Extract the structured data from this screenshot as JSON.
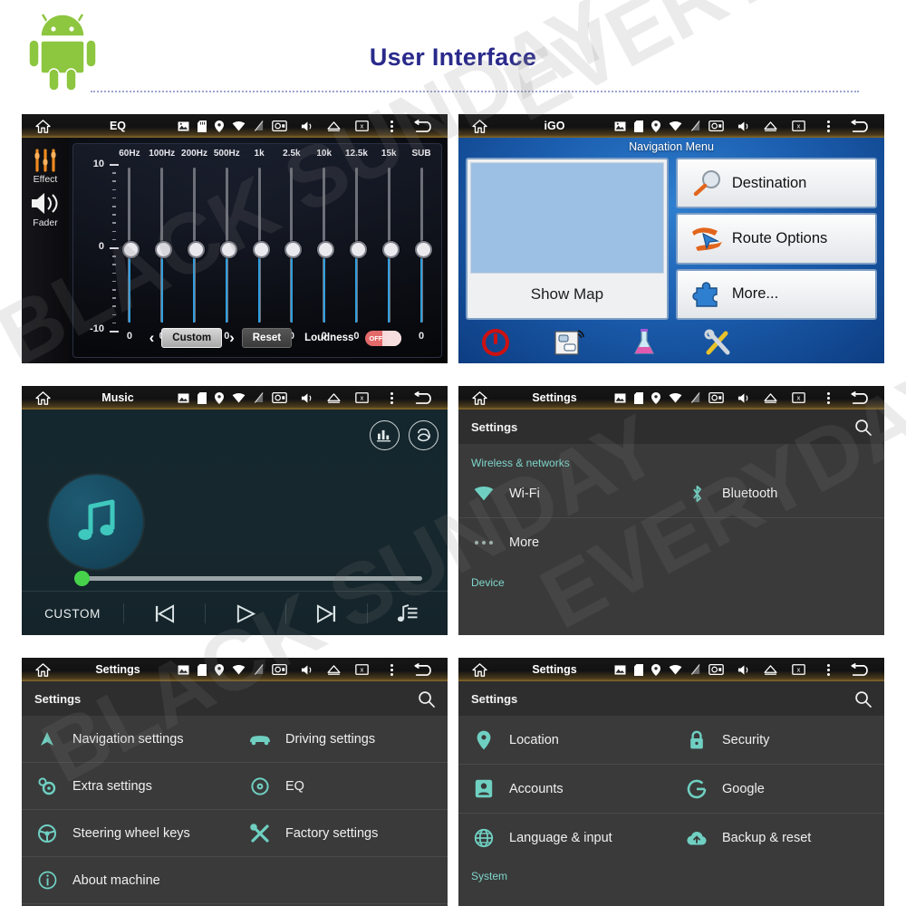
{
  "header": {
    "title": "User Interface",
    "logo_icon": "android-robot-logo",
    "title_color": "#2a2a8c"
  },
  "watermark": {
    "line1": "BLACK SUNDAY",
    "line2": "EVERYDAY"
  },
  "statusbar_icons": [
    "image-icon",
    "sd-card-icon",
    "location-pin-icon",
    "wifi-icon",
    "signal-off-icon",
    "camera-icon",
    "mute-volume-icon",
    "eject-icon",
    "screen-off-icon",
    "overflow-menu-icon"
  ],
  "screens": {
    "eq": {
      "statusbar_title": "EQ",
      "side": {
        "effect_label": "Effect",
        "fader_label": "Fader",
        "effect_icon": "sliders-icon",
        "fader_icon": "speaker-waves-icon",
        "effect_color": "#f08a1e"
      },
      "bands": [
        "60Hz",
        "100Hz",
        "200Hz",
        "500Hz",
        "1k",
        "2.5k",
        "10k",
        "12.5k",
        "15k",
        "SUB"
      ],
      "values": [
        0,
        0,
        0,
        0,
        0,
        0,
        0,
        0,
        0,
        0
      ],
      "axis": {
        "max": "10",
        "mid": "0",
        "min": "-10"
      },
      "controls": {
        "prev_arrow": "‹",
        "next_arrow": "›",
        "preset_label": "Custom",
        "reset_label": "Reset",
        "loudness_label": "Loudness",
        "loudness_state": "OFF"
      }
    },
    "igo": {
      "statusbar_title": "iGO",
      "menu_title": "Navigation Menu",
      "show_map_label": "Show Map",
      "buttons": [
        {
          "label": "Destination",
          "icon": "magnifier-icon"
        },
        {
          "label": "Route Options",
          "icon": "route-arrow-icon"
        },
        {
          "label": "More...",
          "icon": "puzzle-piece-icon"
        }
      ],
      "toolbar_icons": [
        "power-icon",
        "traffic-tmc-icon",
        "beaker-icon",
        "tools-icon"
      ]
    },
    "music": {
      "statusbar_title": "Music",
      "equalizer_icon": "equalizer-icon",
      "repeat_icon": "repeat-icon",
      "album_art_icon": "music-note-icon",
      "progress_percent": 2,
      "mode_label": "CUSTOM",
      "transport": [
        {
          "name": "previous",
          "icon": "skip-previous-icon"
        },
        {
          "name": "play",
          "icon": "play-icon"
        },
        {
          "name": "next",
          "icon": "skip-next-icon"
        }
      ],
      "playlist_icon": "playlist-icon"
    },
    "settings_wireless": {
      "statusbar_title": "Settings",
      "head_title": "Settings",
      "search_icon": "search-icon",
      "groups": [
        {
          "title": "Wireless & networks",
          "rows": [
            {
              "label": "Wi-Fi",
              "icon": "wifi-icon"
            },
            {
              "label": "Bluetooth",
              "icon": "bluetooth-icon"
            },
            {
              "label": "More",
              "icon": "more-dots-icon"
            }
          ]
        },
        {
          "title": "Device",
          "rows": []
        }
      ]
    },
    "settings_device": {
      "statusbar_title": "Settings",
      "head_title": "Settings",
      "search_icon": "search-icon",
      "rows": [
        {
          "label": "Navigation settings",
          "icon": "navigation-arrow-icon"
        },
        {
          "label": "Driving settings",
          "icon": "car-icon"
        },
        {
          "label": "Extra settings",
          "icon": "gears-icon"
        },
        {
          "label": "EQ",
          "icon": "speaker-icon"
        },
        {
          "label": "Steering wheel keys",
          "icon": "steering-wheel-icon"
        },
        {
          "label": "Factory settings",
          "icon": "tools-icon"
        },
        {
          "label": "About machine",
          "icon": "info-icon"
        }
      ]
    },
    "settings_personal": {
      "statusbar_title": "Settings",
      "head_title": "Settings",
      "search_icon": "search-icon",
      "rows": [
        {
          "label": "Location",
          "icon": "location-pin-icon"
        },
        {
          "label": "Security",
          "icon": "lock-icon"
        },
        {
          "label": "Accounts",
          "icon": "account-icon"
        },
        {
          "label": "Google",
          "icon": "google-g-icon"
        },
        {
          "label": "Language & input",
          "icon": "globe-icon"
        },
        {
          "label": "Backup & reset",
          "icon": "cloud-upload-icon"
        }
      ],
      "footer_group": "System"
    }
  },
  "colors": {
    "teal": "#6fd0c2",
    "accent_blue": "#2f9ede",
    "green": "#46d24a",
    "orange": "#f08a1e"
  }
}
